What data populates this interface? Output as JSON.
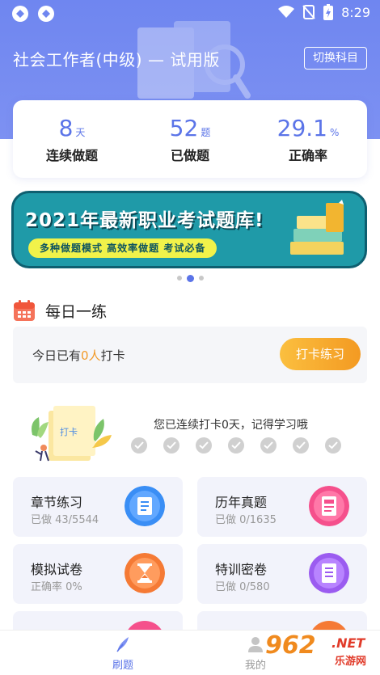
{
  "status_bar": {
    "time": "8:29"
  },
  "header": {
    "title": "社会工作者(中级) — 试用版",
    "switch_label": "切换科目"
  },
  "stats": [
    {
      "value": "8",
      "unit": "天",
      "label": "连续做题"
    },
    {
      "value": "52",
      "unit": "题",
      "label": "已做题"
    },
    {
      "value": "29.1",
      "unit": "%",
      "label": "正确率"
    }
  ],
  "banner": {
    "title": "2021年最新职业考试题库!",
    "subtitle": "多种做题模式 高效率做题 考试必备"
  },
  "carousel": {
    "count": 3,
    "active": 1
  },
  "daily": {
    "title": "每日一练",
    "checkin_prefix": "今日已有",
    "checkin_count": "0人",
    "checkin_suffix": "打卡",
    "checkin_button": "打卡练习",
    "illustration_label": "打卡",
    "streak_text": "您已连续打卡0天，记得学习哦"
  },
  "tiles": [
    {
      "name": "章节练习",
      "sub": "已做 43/5544",
      "icon": "notebook-icon",
      "color": "#3a8ef5"
    },
    {
      "name": "历年真题",
      "sub": "已做 0/1635",
      "icon": "paper-icon",
      "color": "#f5508c"
    },
    {
      "name": "模拟试卷",
      "sub": "正确率 0%",
      "icon": "hourglass-icon",
      "color": "#f57a35"
    },
    {
      "name": "特训密卷",
      "sub": "已做 0/580",
      "icon": "scroll-icon",
      "color": "#9b5cf0"
    }
  ],
  "tabbar": {
    "items": [
      {
        "label": "刷题",
        "icon": "quill-icon",
        "active": true
      },
      {
        "label": "我的",
        "icon": "user-icon",
        "active": false
      }
    ]
  },
  "watermark": {
    "brand": "962",
    "net": ".NET",
    "sub": "乐游网"
  },
  "colors": {
    "primary": "#5b74e8",
    "accent": "#f39a22"
  }
}
